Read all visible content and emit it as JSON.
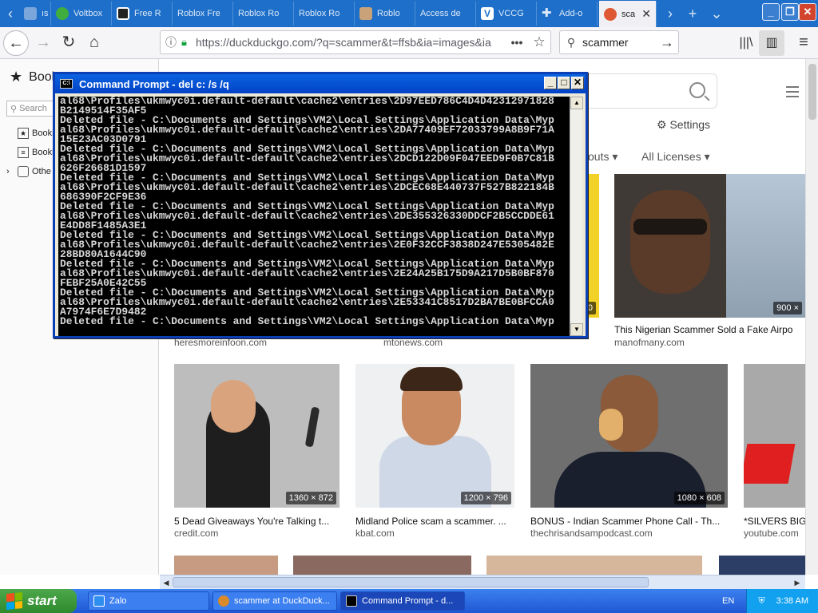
{
  "browser": {
    "tabs": [
      {
        "label": "ıs M",
        "icon": "generic-tab-icon"
      },
      {
        "label": "Voltbox",
        "icon": "voltbox-icon"
      },
      {
        "label": "Free R",
        "icon": "roblox-icon"
      },
      {
        "label": "Roblox Fre",
        "icon": "blank-icon"
      },
      {
        "label": "Roblox Ro",
        "icon": "blank-icon"
      },
      {
        "label": "Roblox Ro",
        "icon": "blank-icon"
      },
      {
        "label": "Roblo",
        "icon": "avatar-icon"
      },
      {
        "label": "Access de",
        "icon": "blank-icon"
      },
      {
        "label": "VCCG",
        "icon": "vccg-icon"
      },
      {
        "label": "Add-o",
        "icon": "puzzle-icon"
      },
      {
        "label": "sca",
        "icon": "duckduckgo-icon"
      }
    ],
    "address": "https://duckduckgo.com/?q=scammer&t=ffsb&ia=images&ia",
    "search_query": "scammer",
    "sidebar": {
      "title": "Book",
      "search_placeholder": "Search",
      "items": [
        "Booki",
        "Booki",
        "Othe"
      ]
    }
  },
  "page": {
    "settings_label": "Settings",
    "filters": [
      "outs",
      "All Licenses"
    ],
    "row1": [
      {
        "caption": "This Nigerian Scammer Sold a Fake Airpo",
        "source": "manofmany.com",
        "dims": "900 ×"
      },
      {
        "caption": "",
        "source": "heresmoreinfoon.com",
        "dims": ""
      },
      {
        "caption": "",
        "source": "mtonews.com",
        "dims": "00"
      }
    ],
    "row2": [
      {
        "caption": "5 Dead Giveaways You're Talking t...",
        "source": "credit.com",
        "dims": "1360 × 872"
      },
      {
        "caption": "Midland Police scam a scammer. ...",
        "source": "kbat.com",
        "dims": "1200 × 796"
      },
      {
        "caption": "BONUS - Indian Scammer Phone Call - Th...",
        "source": "thechrisandsampodcast.com",
        "dims": "1080 × 608"
      },
      {
        "caption": "*SILVERS BIG",
        "source": "youtube.com",
        "dims": ""
      }
    ]
  },
  "cmd": {
    "title": "Command Prompt - del c: /s /q",
    "lines": [
      "al68\\Profiles\\ukmwyc0i.default-default\\cache2\\entries\\2D97EED786C4D4D42312971828",
      "B2149514F35AF5",
      "Deleted file - C:\\Documents and Settings\\VM2\\Local Settings\\Application Data\\Myp",
      "al68\\Profiles\\ukmwyc0i.default-default\\cache2\\entries\\2DA77409EF72033799A8B9F71A",
      "15E23AC03D0791",
      "Deleted file - C:\\Documents and Settings\\VM2\\Local Settings\\Application Data\\Myp",
      "al68\\Profiles\\ukmwyc0i.default-default\\cache2\\entries\\2DCD122D09F047EED9F0B7C81B",
      "626F26681D1597",
      "Deleted file - C:\\Documents and Settings\\VM2\\Local Settings\\Application Data\\Myp",
      "al68\\Profiles\\ukmwyc0i.default-default\\cache2\\entries\\2DCEC68E440737F527B822184B",
      "686390F2CF9E36",
      "Deleted file - C:\\Documents and Settings\\VM2\\Local Settings\\Application Data\\Myp",
      "al68\\Profiles\\ukmwyc0i.default-default\\cache2\\entries\\2DE355326330DDCF2B5CCDDE61",
      "E4DD8F1485A3E1",
      "Deleted file - C:\\Documents and Settings\\VM2\\Local Settings\\Application Data\\Myp",
      "al68\\Profiles\\ukmwyc0i.default-default\\cache2\\entries\\2E0F32CCF3838D247E5305482E",
      "28BD80A1644C90",
      "Deleted file - C:\\Documents and Settings\\VM2\\Local Settings\\Application Data\\Myp",
      "al68\\Profiles\\ukmwyc0i.default-default\\cache2\\entries\\2E24A25B175D9A217D5B0BF870",
      "FEBF25A0E42C55",
      "Deleted file - C:\\Documents and Settings\\VM2\\Local Settings\\Application Data\\Myp",
      "al68\\Profiles\\ukmwyc0i.default-default\\cache2\\entries\\2E53341C8517D2BA7BE0BFCCA0",
      "A7974F6E7D9482",
      "Deleted file - C:\\Documents and Settings\\VM2\\Local Settings\\Application Data\\Myp"
    ]
  },
  "taskbar": {
    "start": "start",
    "tasks": [
      {
        "label": "Zalo"
      },
      {
        "label": "scammer at DuckDuck..."
      },
      {
        "label": "Command Prompt - d..."
      }
    ],
    "lang": "EN",
    "time": "3:38 AM"
  },
  "colors": {
    "tabstrip": "#1d6fc9",
    "xp_title": "#0242c8",
    "taskbar": "#245edb",
    "start": "#3a9a38"
  }
}
